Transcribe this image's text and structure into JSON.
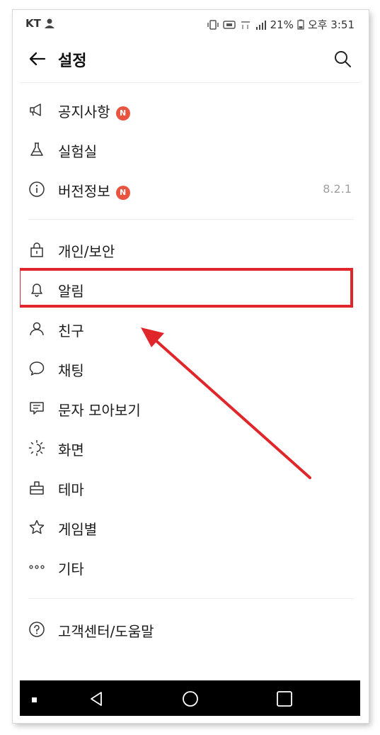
{
  "status_bar": {
    "carrier": "KT",
    "battery": "21%",
    "time": "오후 3:51"
  },
  "header": {
    "title": "설정",
    "back_icon": "arrow-left-icon",
    "search_icon": "search-icon"
  },
  "menu": {
    "items": [
      {
        "label": "공지사항",
        "icon": "megaphone-icon",
        "badge": "N"
      },
      {
        "label": "실험실",
        "icon": "flask-icon"
      },
      {
        "label": "버전정보",
        "icon": "info-icon",
        "badge": "N",
        "value": "8.2.1"
      },
      {
        "label": "개인/보안",
        "icon": "lock-icon"
      },
      {
        "label": "알림",
        "icon": "bell-icon"
      },
      {
        "label": "친구",
        "icon": "person-icon"
      },
      {
        "label": "채팅",
        "icon": "chat-bubble-icon"
      },
      {
        "label": "문자 모아보기",
        "icon": "message-icon"
      },
      {
        "label": "화면",
        "icon": "brightness-icon"
      },
      {
        "label": "테마",
        "icon": "theme-brush-icon"
      },
      {
        "label": "게임별",
        "icon": "star-icon"
      },
      {
        "label": "기타",
        "icon": "more-dots-icon"
      },
      {
        "label": "고객센터/도움말",
        "icon": "help-icon"
      }
    ]
  },
  "colors": {
    "badge": "#e8543f",
    "highlight": "#e0262b",
    "arrow": "#e0262b"
  }
}
